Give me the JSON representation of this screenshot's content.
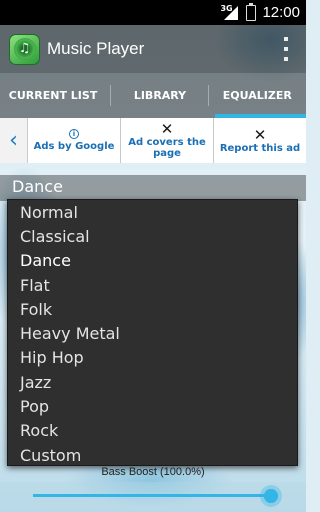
{
  "status_bar": {
    "network": "3G",
    "time": "12:00",
    "icons": [
      "signal-icon",
      "battery-icon"
    ]
  },
  "action_bar": {
    "title": "Music Player",
    "app_icon": "music-disc-icon",
    "overflow_icon": "overflow-menu-icon"
  },
  "tabs": [
    {
      "label": "CURRENT LIST",
      "active": false
    },
    {
      "label": "LIBRARY",
      "active": false
    },
    {
      "label": "EQUALIZER",
      "active": true
    }
  ],
  "ad_bar": {
    "back_icon": "chevron-left-icon",
    "items": [
      {
        "label": "Ads by Google",
        "icon": "info-icon"
      },
      {
        "label": "Ad covers the page",
        "icon": "close-icon"
      },
      {
        "label": "Report this ad",
        "icon": "close-icon"
      }
    ]
  },
  "equalizer": {
    "current_preset": "Dance",
    "presets": [
      "Normal",
      "Classical",
      "Dance",
      "Flat",
      "Folk",
      "Heavy Metal",
      "Hip Hop",
      "Jazz",
      "Pop",
      "Rock",
      "Custom"
    ],
    "bass_boost_label": "Bass Boost (100.0%)",
    "bass_boost_value": 1.0
  },
  "colors": {
    "accent": "#33b5e5",
    "ad_text": "#1b6fb4",
    "dropdown_bg": "#2f2f2f"
  }
}
